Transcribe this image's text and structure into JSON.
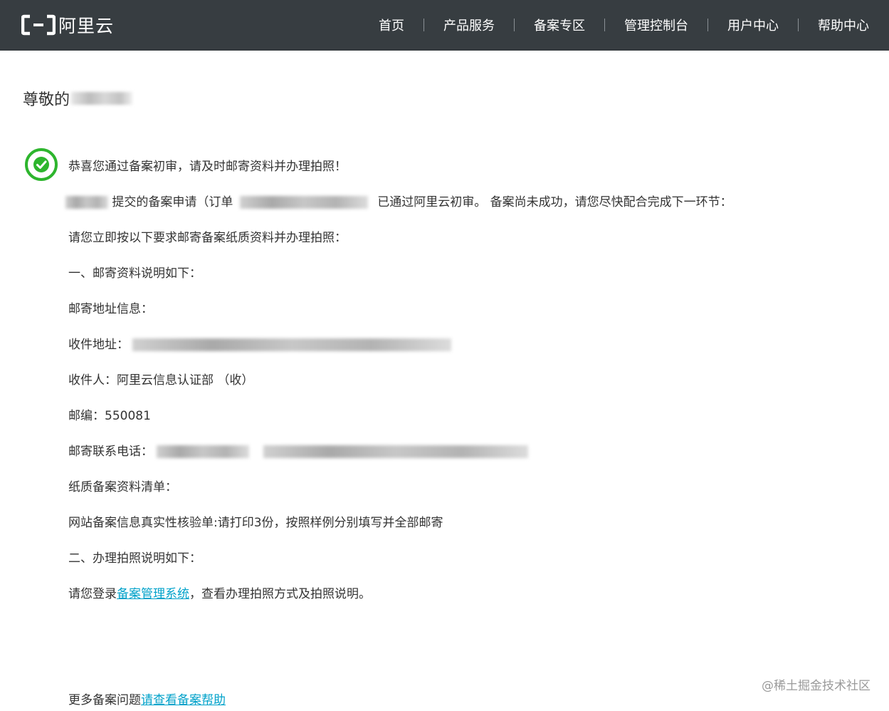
{
  "header": {
    "logo_text": "阿里云",
    "nav": [
      {
        "label": "首页"
      },
      {
        "label": "产品服务"
      },
      {
        "label": "备案专区"
      },
      {
        "label": "管理控制台"
      },
      {
        "label": "用户中心"
      },
      {
        "label": "帮助中心"
      }
    ],
    "colors": {
      "bar": "#373d41",
      "text": "#ffffff"
    }
  },
  "content": {
    "greeting": "尊敬的",
    "success_title": "恭喜您通过备案初审，请及时邮寄资料并办理拍照！",
    "submit_line": {
      "part1": "提交的备案申请（订单",
      "part2": "已通过阿里云初审。 备案尚未成功，请您尽快配合完成下一环节："
    },
    "instruction": "请您立即按以下要求邮寄备案纸质资料并办理拍照：",
    "section1_title": "一、邮寄资料说明如下：",
    "mail_info_label": "邮寄地址信息：",
    "recipient_address_label": "收件地址：",
    "recipient": "收件人：阿里云信息认证部 （收）",
    "postcode": "邮编：550081",
    "phone_label": "邮寄联系电话：",
    "paper_list_label": "纸质备案资料清单：",
    "paper_list_item": "网站备案信息真实性核验单:请打印3份，按照样例分别填写并全部邮寄",
    "section2_title": "二、办理拍照说明如下：",
    "photo_line": {
      "prefix": "请您登录",
      "link": "备案管理系统",
      "suffix": "，查看办理拍照方式及拍照说明。"
    },
    "more_help": {
      "prefix": "更多备案问题",
      "link": "请查看备案帮助"
    },
    "link_color": "#00a2ca",
    "success_color": "#2db52d"
  },
  "watermark": "@稀土掘金技术社区"
}
